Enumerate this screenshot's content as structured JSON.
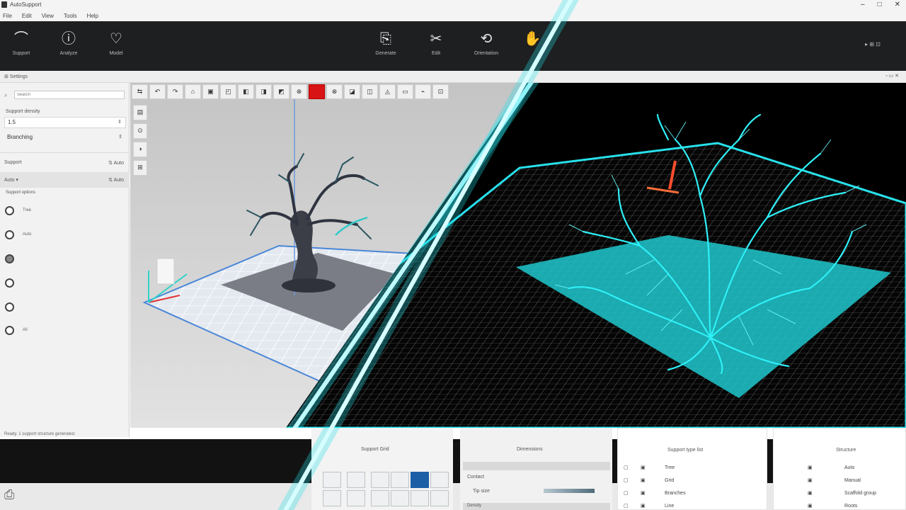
{
  "app": {
    "title": "AutoSupport"
  },
  "window_controls": {
    "minimize": "–",
    "maximize": "□",
    "close": "✕"
  },
  "menu": [
    "File",
    "Edit",
    "View",
    "Tools",
    "Help"
  ],
  "toolbar": {
    "buttons": [
      {
        "icon": "headset-icon",
        "glyph": "⌒",
        "label": "Support"
      },
      {
        "icon": "info-icon",
        "glyph": "ⓘ",
        "label": "Analyze"
      },
      {
        "icon": "tooth-icon",
        "glyph": "♡",
        "label": "Model"
      },
      {
        "icon": "clipboard-icon",
        "glyph": "⎘",
        "label": "Generate"
      },
      {
        "icon": "cut-icon",
        "glyph": "✂",
        "label": "Edit"
      },
      {
        "icon": "rotate-icon",
        "glyph": "⟲",
        "label": "Orientation"
      },
      {
        "icon": "hand-icon",
        "glyph": "✋",
        "label": ""
      }
    ],
    "right_text": "▸ ⊞ ⊡"
  },
  "strip": {
    "left": "⊞ Settings",
    "right": "▫ ▭ ✕"
  },
  "left_panel": {
    "search_placeholder": "Search",
    "density_label": "Support density",
    "density_value": "1.5",
    "template_label": "Branching",
    "rows": [
      {
        "label": "Support",
        "control": "⇅ Auto"
      },
      {
        "label": "Auto ▾",
        "control": "⇅ Auto"
      }
    ],
    "options_label": "Support options",
    "radios": [
      "Tree",
      "Auto",
      "",
      "",
      "",
      "All"
    ],
    "status": "Ready. 1 support structure generated."
  },
  "viewport": {
    "tools": [
      "⇆",
      "↶",
      "↷",
      "⌂",
      "▣",
      "◰",
      "◧",
      "◨",
      "◩",
      "⊕",
      "",
      "⊗",
      "◪",
      "◫",
      "◬",
      "▭",
      "⌁",
      "⊡"
    ],
    "side_tools": [
      "▤",
      "⊙",
      "◑",
      "⊞"
    ]
  },
  "bottom": {
    "panel1_title": "Support Grid",
    "panel2_title": "Dimensions",
    "panel2_rows": [
      "Contact",
      "Tip size",
      "Density"
    ],
    "panel3_title": "Support type list",
    "panel3_rows": [
      "Tree",
      "Grid",
      "Branches",
      "Line"
    ],
    "panel4_title": "Structure",
    "panel4_rows": [
      "Auto",
      "Manual",
      "Scaffold group",
      "Roots"
    ]
  },
  "colors": {
    "accent_red": "#d91414",
    "glow_cyan": "#27e1ec",
    "grid_blue": "#1c5fa6"
  }
}
